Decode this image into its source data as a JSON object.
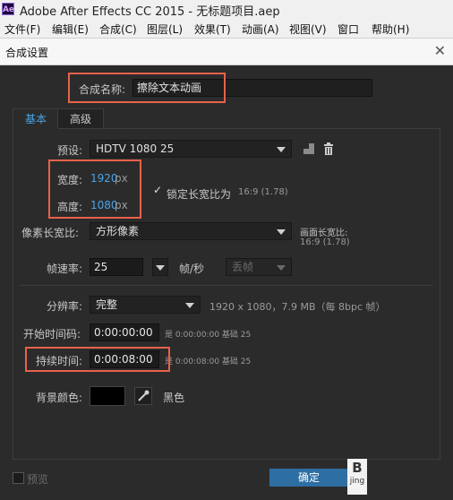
{
  "window": {
    "logo": "Ae",
    "title": "Adobe After Effects CC 2015 - 无标题项目.aep"
  },
  "menu": [
    "文件(F)",
    "编辑(E)",
    "合成(C)",
    "图层(L)",
    "效果(T)",
    "动画(A)",
    "视图(V)",
    "窗口",
    "帮助(H)"
  ],
  "dialog": {
    "title": "合成设置",
    "comp_name_label": "合成名称:",
    "comp_name_value": "擦除文本动画",
    "tabs": [
      "基本",
      "高级"
    ],
    "preset_label": "预设:",
    "preset_value": "HDTV 1080 25",
    "width_label": "宽度:",
    "width_value": "1920",
    "height_label": "高度:",
    "height_value": "1080",
    "px_unit": "px",
    "lock_label": "锁定长宽比为",
    "lock_ratio": "16:9 (1.78)",
    "pixel_aspect_label": "像素长宽比:",
    "pixel_aspect_value": "方形像素",
    "frame_aspect_label": "画面长宽比:",
    "frame_aspect_value": "16:9 (1.78)",
    "frame_rate_label": "帧速率:",
    "frame_rate_value": "25",
    "fps_unit": "帧/秒",
    "drop_frame": "丢帧",
    "resolution_label": "分辨率:",
    "resolution_value": "完整",
    "resolution_info": "1920 x 1080，7.9 MB（每 8bpc 帧）",
    "start_tc_label": "开始时间码:",
    "start_tc_value": "0:00:00:00",
    "start_tc_info": "是 0:00:00:00  基础 25",
    "duration_label": "持续时间:",
    "duration_value": "0:00:08:00",
    "duration_info": "是 0:00:08:00  基础 25",
    "bg_color_label": "背景颜色:",
    "bg_color_name": "黑色",
    "bg_color_hex": "#000000",
    "preview_label": "预览",
    "ok_label": "确定",
    "watermark": "jing"
  }
}
